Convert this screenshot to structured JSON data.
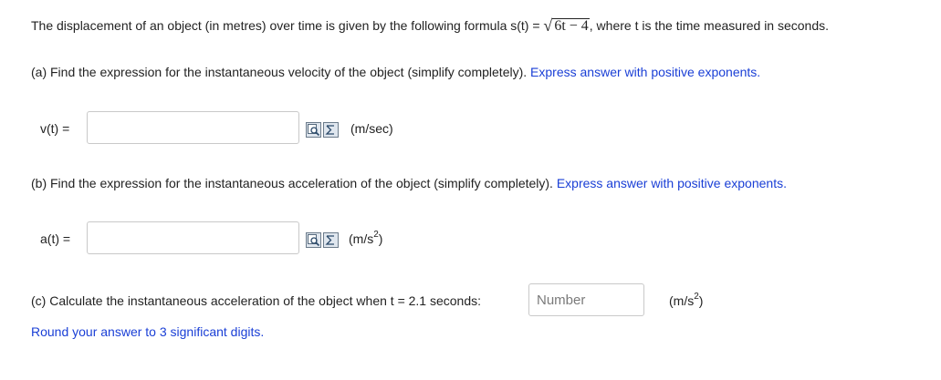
{
  "intro": {
    "text_before": "The displacement of an object (in metres) over time is given by the following formula s(t) = ",
    "formula_radicand": "6t − 4",
    "text_after": ", where t is the time measured in seconds."
  },
  "part_a": {
    "question": "(a) Find the expression for the instantaneous velocity of the object (simplify completely).",
    "hint": "Express answer with positive exponents.",
    "label": "v(t) =",
    "unit": "(m/sec)"
  },
  "part_b": {
    "question": "(b) Find the expression for the instantaneous acceleration of the object (simplify completely).",
    "hint": "Express answer with positive exponents.",
    "label": "a(t) =",
    "unit_base": "(m/s",
    "unit_exp": "2",
    "unit_close": ")"
  },
  "part_c": {
    "question": "(c) Calculate the instantaneous acceleration of the object when t = 2.1 seconds:",
    "placeholder": "Number",
    "unit_base": "(m/s",
    "unit_exp": "2",
    "unit_close": ")",
    "note": "Round your answer to 3 significant digits."
  },
  "icons": [
    "preview-icon",
    "equation-editor-icon"
  ],
  "colors": {
    "hint": "#1a3fd6",
    "text": "#222222",
    "border": "#c9c9c9"
  }
}
